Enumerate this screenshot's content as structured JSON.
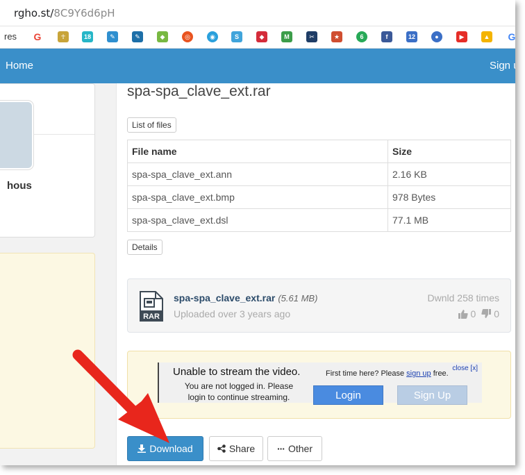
{
  "browser": {
    "url_host": "rgho.st/",
    "url_path": "8C9Y6d6pH",
    "bookmarks_partial_label": "res",
    "bookmark_icons": [
      {
        "name": "google-icon",
        "glyph": "G",
        "color": "#ea4335"
      },
      {
        "name": "figure-icon",
        "glyph": "☥",
        "color": "#c8a43a"
      },
      {
        "name": "bookmark-icon-3",
        "glyph": "18",
        "color": "#26b6c7"
      },
      {
        "name": "edit-icon",
        "glyph": "✎",
        "color": "#2f8fcf"
      },
      {
        "name": "edit-icon-2",
        "glyph": "✎",
        "color": "#1d6fa8"
      },
      {
        "name": "android-icon",
        "glyph": "◆",
        "color": "#78b842"
      },
      {
        "name": "ubuntu-icon",
        "glyph": "◎",
        "color": "#e95420"
      },
      {
        "name": "target-icon",
        "glyph": "◉",
        "color": "#2aa0dc"
      },
      {
        "name": "swirl-icon",
        "glyph": "S",
        "color": "#40a4db"
      },
      {
        "name": "red-cube-icon",
        "glyph": "◆",
        "color": "#d42c3a"
      },
      {
        "name": "m-icon",
        "glyph": "M",
        "color": "#3c9d4a"
      },
      {
        "name": "scissors-icon",
        "glyph": "✂",
        "color": "#1f3d66"
      },
      {
        "name": "star-icon",
        "glyph": "★",
        "color": "#d04e30"
      },
      {
        "name": "six-icon",
        "glyph": "6",
        "color": "#27a957"
      },
      {
        "name": "facebook-icon",
        "glyph": "f",
        "color": "#3b5998"
      },
      {
        "name": "calendar-icon",
        "glyph": "12",
        "color": "#3b6fc6"
      },
      {
        "name": "user-icon",
        "glyph": "●",
        "color": "#3b6fc6"
      },
      {
        "name": "youtube-icon",
        "glyph": "▶",
        "color": "#e52d27"
      },
      {
        "name": "drive-icon",
        "glyph": "▲",
        "color": "#f4b400"
      },
      {
        "name": "google-partial-icon",
        "glyph": "G",
        "color": "#4285f4"
      }
    ]
  },
  "nav": {
    "home_label": "Home",
    "signup_label": "Sign up"
  },
  "profile": {
    "username_partial": "hous"
  },
  "file": {
    "title": "spa-spa_clave_ext.rar",
    "list_of_files_label": "List of files",
    "columns": [
      "File name",
      "Size"
    ],
    "rows": [
      [
        "spa-spa_clave_ext.ann",
        "2.16 KB"
      ],
      [
        "spa-spa_clave_ext.bmp",
        "978 Bytes"
      ],
      [
        "spa-spa_clave_ext.dsl",
        "77.1 MB"
      ]
    ],
    "details_label": "Details",
    "card": {
      "icon_label": "RAR",
      "name": "spa-spa_clave_ext.rar",
      "size": "(5.61 MB)",
      "uploaded": "Uploaded over 3 years ago",
      "downloads": "Dwnld 258 times",
      "likes": "0",
      "dislikes": "0"
    }
  },
  "stream": {
    "unable": "Unable to stream the video.",
    "not_logged": "You are not logged in. Please login to continue streaming.",
    "first_time_prefix": "First time here? Please",
    "first_time_link": "sign up",
    "first_time_suffix": "free.",
    "close_label": "close [x]",
    "login_label": "Login",
    "signup_label": "Sign Up"
  },
  "actions": {
    "download_label": "Download",
    "share_label": "Share",
    "other_label": "Other"
  },
  "colors": {
    "brand_blue": "#3a8fc9",
    "arrow_red": "#e8261c",
    "warning_bg": "#fcf8e3"
  }
}
